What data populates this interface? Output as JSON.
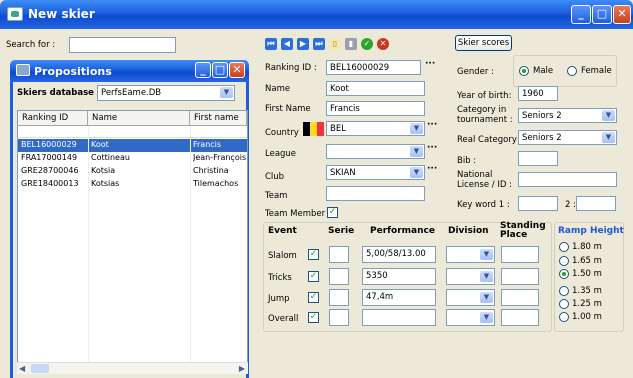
{
  "window": {
    "title": "New skier"
  },
  "search": {
    "label": "Search for :",
    "value": ""
  },
  "propositions": {
    "title": "Propositions",
    "db_label": "Skiers database :",
    "db_value": "PerfsEame.DB",
    "columns": [
      "Ranking ID",
      "Name",
      "First name"
    ],
    "rows": [
      {
        "id": "BEL16000029",
        "name": "Koot",
        "first": "Francis",
        "selected": true
      },
      {
        "id": "FRA17000149",
        "name": "Cottineau",
        "first": "Jean-François",
        "selected": false
      },
      {
        "id": "GRE28700046",
        "name": "Kotsia",
        "first": "Christina",
        "selected": false
      },
      {
        "id": "GRE18400013",
        "name": "Kotsias",
        "first": "Tilemachos",
        "selected": false
      }
    ]
  },
  "toolbar": {
    "icons": [
      "first-icon",
      "prev-icon",
      "next-icon",
      "last-icon",
      "new-doc-icon",
      "delete-icon",
      "ok-icon",
      "cancel-icon"
    ],
    "skier_scores": "Skier scores"
  },
  "form": {
    "ranking_id": {
      "label": "Ranking ID :",
      "value": "BEL16000029"
    },
    "name": {
      "label": "Name",
      "value": "Koot"
    },
    "first_name": {
      "label": "First Name",
      "value": "Francis"
    },
    "country": {
      "label": "Country",
      "value": "BEL"
    },
    "league": {
      "label": "League",
      "value": ""
    },
    "club": {
      "label": "Club",
      "value": "SKIAN"
    },
    "team": {
      "label": "Team",
      "value": ""
    },
    "team_member": {
      "label": "Team Member",
      "checked": true
    },
    "gender": {
      "label": "Gender :",
      "options": [
        "Male",
        "Female"
      ],
      "selected": "Male"
    },
    "year": {
      "label": "Year of birth:",
      "value": "1960"
    },
    "category": {
      "label": "Category in tournament :",
      "value": "Seniors 2"
    },
    "real_category": {
      "label": "Real Category :",
      "value": "Seniors 2"
    },
    "bib": {
      "label": "Bib :",
      "value": ""
    },
    "national_license": {
      "label": "National License / ID :",
      "value": ""
    },
    "key_word": {
      "label": "Key word 1 :",
      "value": "",
      "sep": "2 :",
      "value2": ""
    }
  },
  "events": {
    "headers": {
      "event": "Event",
      "serie": "Serie",
      "performance": "Performance",
      "division": "Division",
      "standing": "Standing Place"
    },
    "rows": [
      {
        "name": "Slalom",
        "checked": true,
        "serie": "",
        "performance": "5,00/58/13.00",
        "division": "",
        "place": ""
      },
      {
        "name": "Tricks",
        "checked": true,
        "serie": "",
        "performance": "5350",
        "division": "",
        "place": ""
      },
      {
        "name": "Jump",
        "checked": true,
        "serie": "",
        "performance": "47,4m",
        "division": "",
        "place": ""
      },
      {
        "name": "Overall",
        "checked": true,
        "serie": "",
        "performance": "",
        "division": "",
        "place": ""
      }
    ]
  },
  "ramp": {
    "title": "Ramp Height",
    "options": [
      "1.80 m",
      "1.65 m",
      "1.50 m",
      "1.35 m",
      "1.25 m",
      "1.00 m"
    ],
    "selected": "1.50 m"
  }
}
